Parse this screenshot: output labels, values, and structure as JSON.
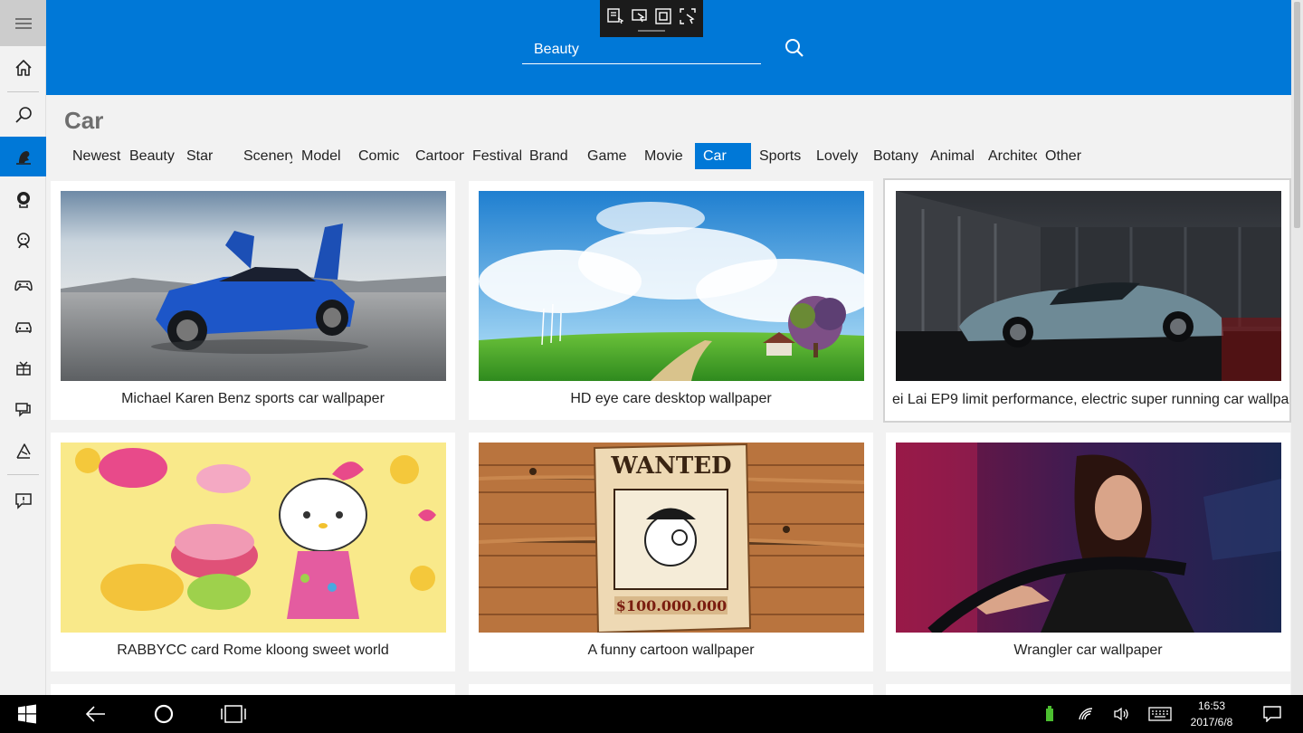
{
  "search": {
    "value": "Beauty"
  },
  "page": {
    "title": "Car"
  },
  "categories": [
    {
      "label": "Newest"
    },
    {
      "label": "Beauty"
    },
    {
      "label": "Star"
    },
    {
      "label": "Scenery"
    },
    {
      "label": "Model"
    },
    {
      "label": "Comic"
    },
    {
      "label": "Cartoon"
    },
    {
      "label": "Festival"
    },
    {
      "label": "Brand"
    },
    {
      "label": "Game"
    },
    {
      "label": "Movie"
    },
    {
      "label": "Car",
      "active": true
    },
    {
      "label": "Sports"
    },
    {
      "label": "Lovely"
    },
    {
      "label": "Botany"
    },
    {
      "label": "Animal"
    },
    {
      "label": "Architec"
    },
    {
      "label": "Other"
    }
  ],
  "wallpapers": [
    {
      "caption": "Michael Karen Benz sports car wallpaper",
      "image": "blue-sports-car-image"
    },
    {
      "caption": "HD eye care desktop wallpaper",
      "image": "green-meadow-sky-image"
    },
    {
      "caption": "ei Lai EP9 limit performance, electric super running car wallpap",
      "image": "supercar-garage-image"
    },
    {
      "caption": "RABBYCC card Rome kloong sweet world",
      "image": "hello-kitty-macarons-image"
    },
    {
      "caption": "A funny cartoon wallpaper",
      "image": "wanted-poster-image"
    },
    {
      "caption": "Wrangler car wallpaper",
      "image": "woman-driving-image"
    }
  ],
  "sidebar": {
    "items": [
      {
        "icon": "hamburger-menu-icon"
      },
      {
        "icon": "home-icon"
      },
      {
        "icon": "search-icon"
      },
      {
        "icon": "beauty-category-icon",
        "active": true
      },
      {
        "icon": "star-category-icon"
      },
      {
        "icon": "lovely-category-icon"
      },
      {
        "icon": "game-controller-icon"
      },
      {
        "icon": "car-icon"
      },
      {
        "icon": "gift-icon"
      },
      {
        "icon": "comic-icon"
      },
      {
        "icon": "botany-icon"
      },
      {
        "icon": "feedback-icon"
      }
    ]
  },
  "taskbar": {
    "time": "16:53",
    "date": "2017/6/8"
  },
  "colors": {
    "accent": "#0078d7",
    "card": "#ffffff",
    "background": "#f2f2f2"
  }
}
